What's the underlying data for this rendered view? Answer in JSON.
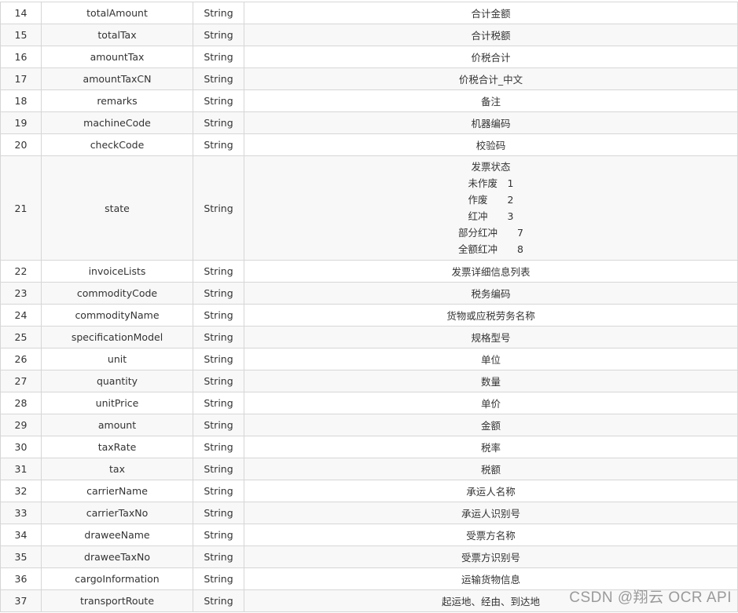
{
  "rows": [
    {
      "no": "14",
      "name": "totalAmount",
      "type": "String",
      "desc": "合计金额"
    },
    {
      "no": "15",
      "name": "totalTax",
      "type": "String",
      "desc": "合计税额"
    },
    {
      "no": "16",
      "name": "amountTax",
      "type": "String",
      "desc": "价税合计"
    },
    {
      "no": "17",
      "name": "amountTaxCN",
      "type": "String",
      "desc": "价税合计_中文"
    },
    {
      "no": "18",
      "name": "remarks",
      "type": "String",
      "desc": "备注"
    },
    {
      "no": "19",
      "name": "machineCode",
      "type": "String",
      "desc": "机器编码"
    },
    {
      "no": "20",
      "name": "checkCode",
      "type": "String",
      "desc": "校验码"
    },
    {
      "no": "21",
      "name": "state",
      "type": "String",
      "desc_lines": [
        "发票状态",
        "未作废　1",
        "作废　　2",
        "红冲　　3",
        "部分红冲　　7",
        "全额红冲　　8"
      ]
    },
    {
      "no": "22",
      "name": "invoiceLists",
      "type": "String",
      "desc": "发票详细信息列表"
    },
    {
      "no": "23",
      "name": "commodityCode",
      "type": "String",
      "desc": "税务编码"
    },
    {
      "no": "24",
      "name": "commodityName",
      "type": "String",
      "desc": "货物或应税劳务名称"
    },
    {
      "no": "25",
      "name": "specificationModel",
      "type": "String",
      "desc": "规格型号"
    },
    {
      "no": "26",
      "name": "unit",
      "type": "String",
      "desc": "单位"
    },
    {
      "no": "27",
      "name": "quantity",
      "type": "String",
      "desc": "数量"
    },
    {
      "no": "28",
      "name": "unitPrice",
      "type": "String",
      "desc": "单价"
    },
    {
      "no": "29",
      "name": "amount",
      "type": "String",
      "desc": "金额"
    },
    {
      "no": "30",
      "name": "taxRate",
      "type": "String",
      "desc": "税率"
    },
    {
      "no": "31",
      "name": "tax",
      "type": "String",
      "desc": "税额"
    },
    {
      "no": "32",
      "name": "carrierName",
      "type": "String",
      "desc": "承运人名称"
    },
    {
      "no": "33",
      "name": "carrierTaxNo",
      "type": "String",
      "desc": "承运人识别号"
    },
    {
      "no": "34",
      "name": "draweeName",
      "type": "String",
      "desc": "受票方名称"
    },
    {
      "no": "35",
      "name": "draweeTaxNo",
      "type": "String",
      "desc": "受票方识别号"
    },
    {
      "no": "36",
      "name": "cargoInformation",
      "type": "String",
      "desc": "运输货物信息"
    },
    {
      "no": "37",
      "name": "transportRoute",
      "type": "String",
      "desc": "起运地、经由、到达地"
    }
  ],
  "watermark": "CSDN @翔云 OCR  API"
}
